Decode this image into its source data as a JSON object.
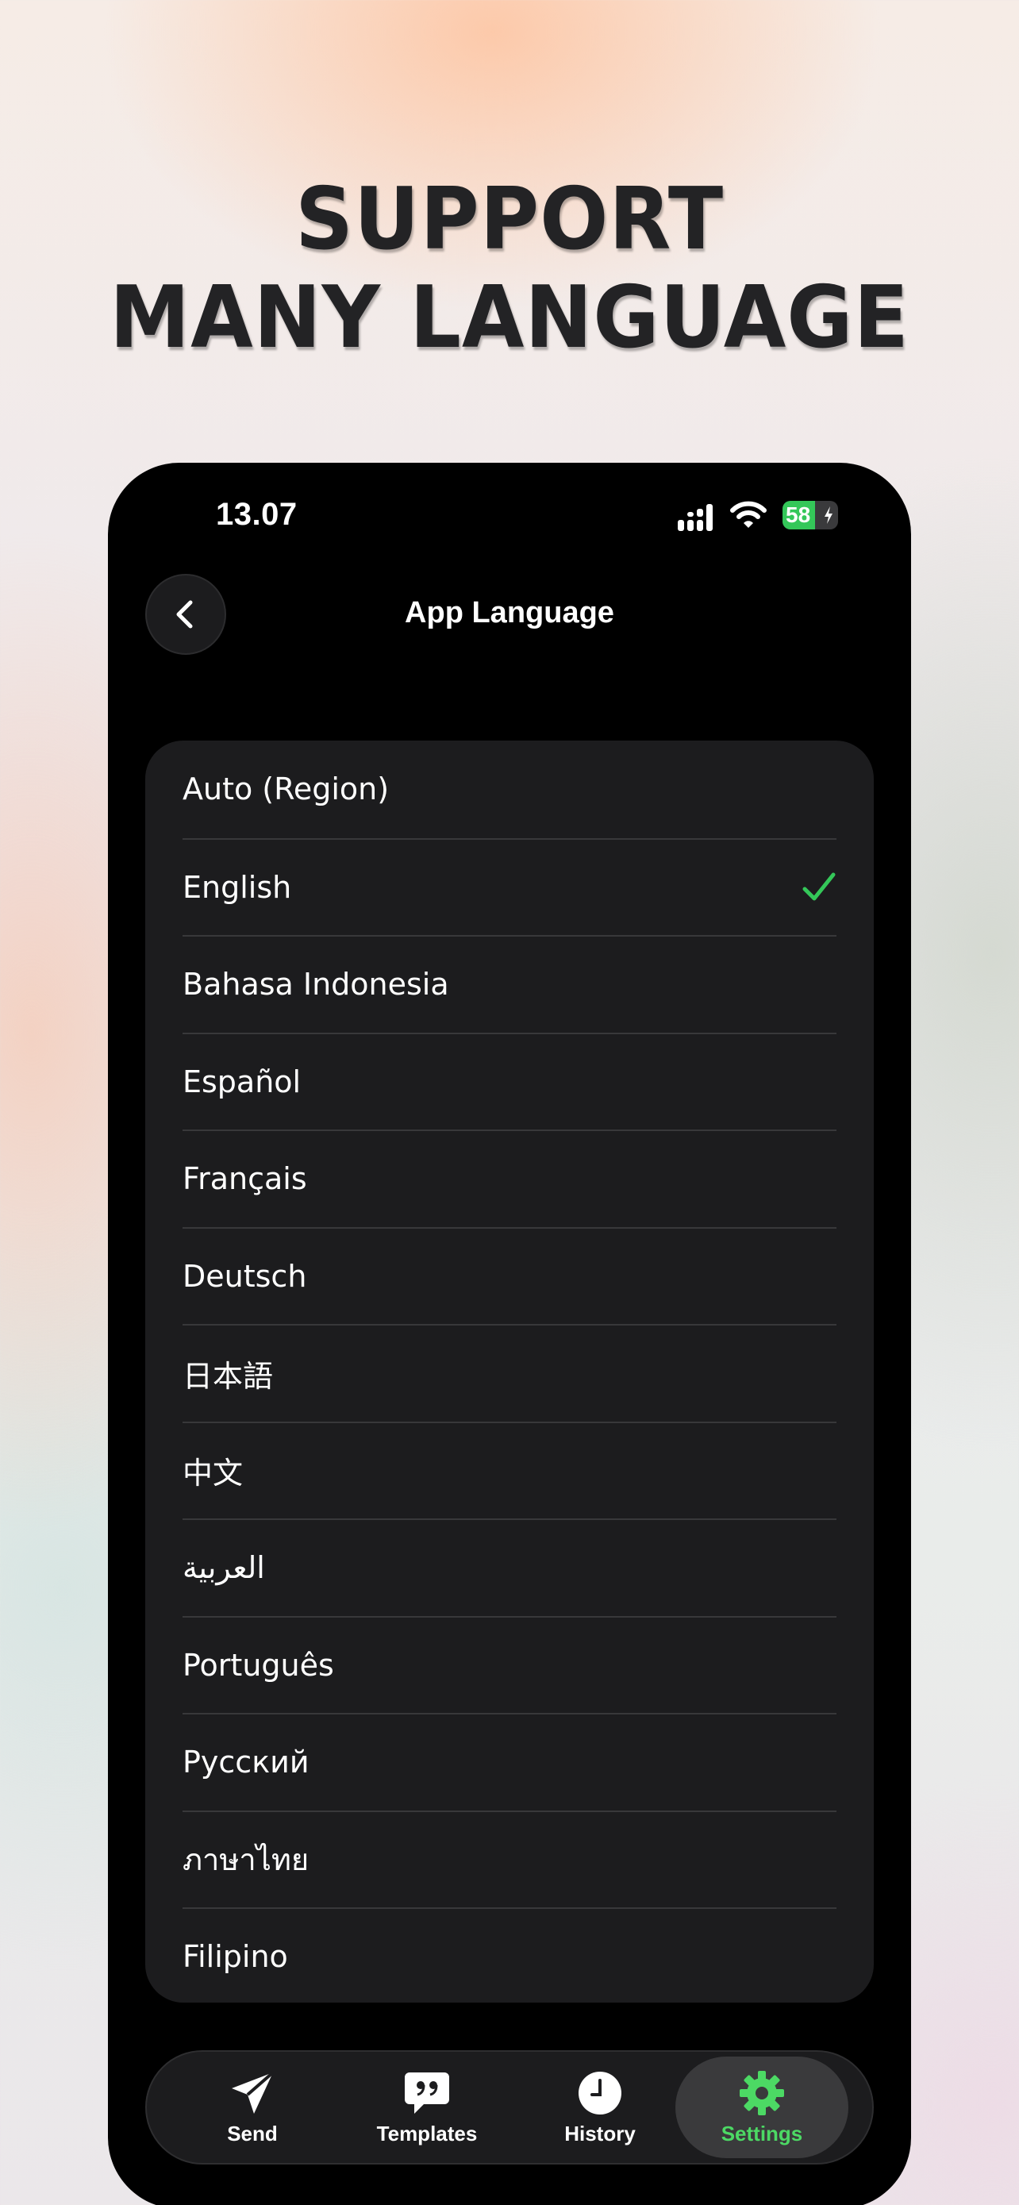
{
  "headline": {
    "line1": "SUPPORT",
    "line2": "MANY LANGUAGE"
  },
  "status_bar": {
    "time": "13.07",
    "battery": "58"
  },
  "nav": {
    "title": "App Language"
  },
  "languages": [
    {
      "label": "Auto (Region)",
      "selected": false
    },
    {
      "label": "English",
      "selected": true
    },
    {
      "label": "Bahasa Indonesia",
      "selected": false
    },
    {
      "label": "Español",
      "selected": false
    },
    {
      "label": "Français",
      "selected": false
    },
    {
      "label": "Deutsch",
      "selected": false
    },
    {
      "label": "日本語",
      "selected": false
    },
    {
      "label": "中文",
      "selected": false
    },
    {
      "label": "العربية",
      "selected": false
    },
    {
      "label": "Português",
      "selected": false
    },
    {
      "label": "Русский",
      "selected": false
    },
    {
      "label": "ภาษาไทย",
      "selected": false
    },
    {
      "label": "Filipino",
      "selected": false
    }
  ],
  "tabs": [
    {
      "label": "Send",
      "icon": "paper-plane-icon",
      "active": false
    },
    {
      "label": "Templates",
      "icon": "quote-bubble-icon",
      "active": false
    },
    {
      "label": "History",
      "icon": "clock-icon",
      "active": false
    },
    {
      "label": "Settings",
      "icon": "gear-icon",
      "active": true
    }
  ],
  "colors": {
    "accent": "#34C759",
    "background": "#000000",
    "card": "#1C1C1E"
  }
}
